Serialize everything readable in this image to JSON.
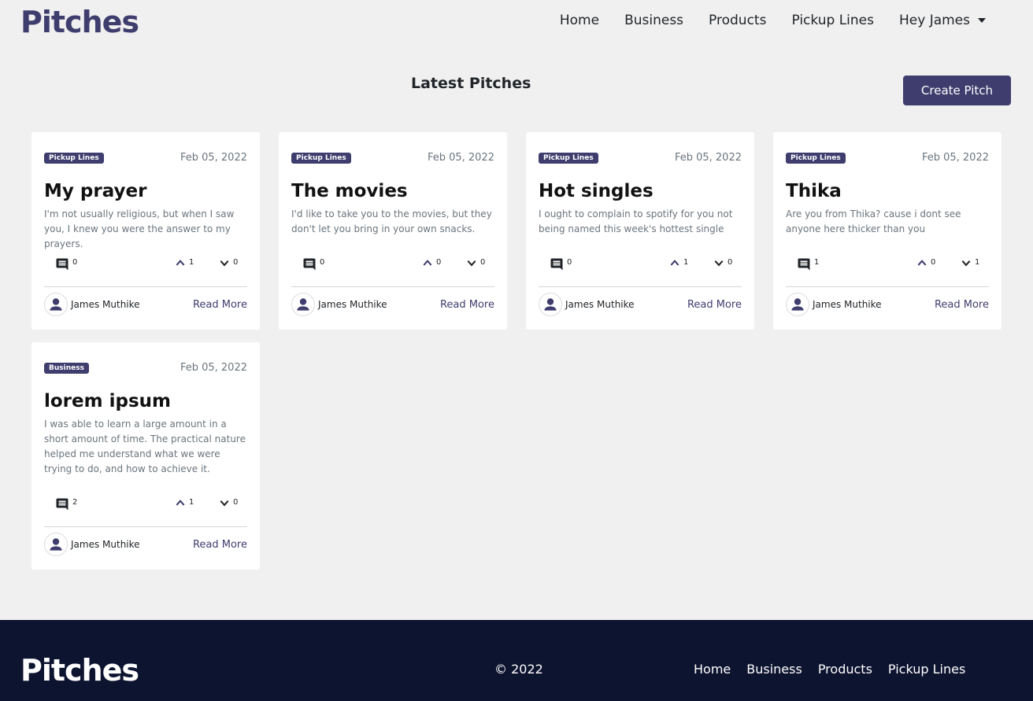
{
  "nav": {
    "brand": "Pitches",
    "links": [
      "Home",
      "Business",
      "Products",
      "Pickup Lines"
    ],
    "user_menu": "Hey James"
  },
  "main": {
    "title": "Latest Pitches",
    "create_label": "Create Pitch"
  },
  "pitches": [
    {
      "category": "Pickup Lines",
      "date": "Feb 05, 2022",
      "title": "My prayer",
      "body": "I'm not usually religious, but when I saw you, I knew you were the answer to my prayers.",
      "comments": "0",
      "upvotes": "1",
      "downvotes": "0",
      "author": "James Muthike",
      "read_more": "Read More"
    },
    {
      "category": "Pickup Lines",
      "date": "Feb 05, 2022",
      "title": "The movies",
      "body": "I'd like to take you to the movies, but they don't let you bring in your own snacks.",
      "comments": "0",
      "upvotes": "0",
      "downvotes": "0",
      "author": "James Muthike",
      "read_more": "Read More"
    },
    {
      "category": "Pickup Lines",
      "date": "Feb 05, 2022",
      "title": "Hot singles",
      "body": "I ought to complain to spotify for you not being named this week's hottest single",
      "comments": "0",
      "upvotes": "1",
      "downvotes": "0",
      "author": "James Muthike",
      "read_more": "Read More"
    },
    {
      "category": "Pickup Lines",
      "date": "Feb 05, 2022",
      "title": "Thika",
      "body": "Are you from Thika? cause i dont see anyone here thicker than you",
      "comments": "1",
      "upvotes": "0",
      "downvotes": "1",
      "author": "James Muthike",
      "read_more": "Read More"
    },
    {
      "category": "Business",
      "date": "Feb 05, 2022",
      "title": "lorem ipsum",
      "body": "I was able to learn a large amount in a short amount of time. The practical nature helped me understand what we were trying to do, and how to achieve it.",
      "comments": "2",
      "upvotes": "1",
      "downvotes": "0",
      "author": "James Muthike",
      "read_more": "Read More"
    }
  ],
  "footer": {
    "brand": "Pitches",
    "copyright": "© 2022",
    "links": [
      "Home",
      "Business",
      "Products",
      "Pickup Lines"
    ]
  },
  "icons": {
    "comment": "comment-icon",
    "upvote": "chevron-up-icon",
    "downvote": "chevron-down-icon",
    "avatar": "user-icon"
  },
  "colors": {
    "brand": "#3f3d6e",
    "footer_bg": "#0d1430",
    "page_bg": "#f0f0f0"
  }
}
